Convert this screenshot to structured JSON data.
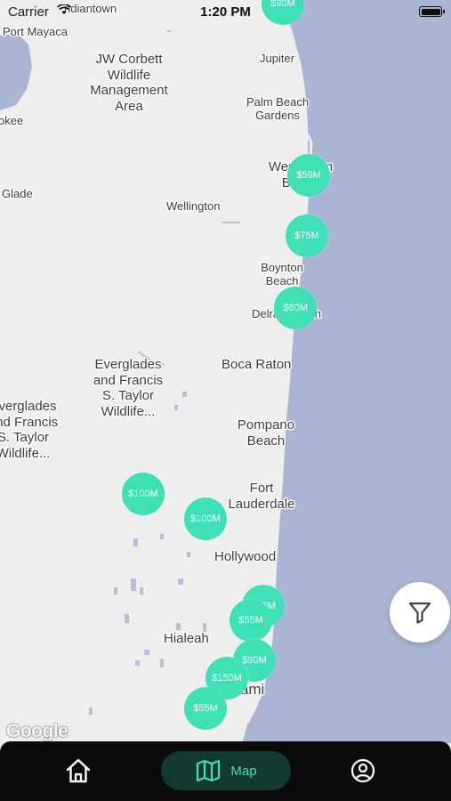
{
  "status_bar": {
    "carrier": "Carrier",
    "time": "1:20 PM"
  },
  "map": {
    "places": [
      {
        "id": "indiantown",
        "text": "ndiantown"
      },
      {
        "id": "port-mayaca",
        "text": "Port Mayaca"
      },
      {
        "id": "jw-corbett",
        "text": "JW Corbett Wildlife Management Area"
      },
      {
        "id": "jupiter",
        "text": "Jupiter"
      },
      {
        "id": "palm-beach-gardens",
        "text": "Palm Beach Gardens"
      },
      {
        "id": "okee",
        "text": "okee"
      },
      {
        "id": "west-palm-beach",
        "text": "West Palm Beach"
      },
      {
        "id": "glade",
        "text": "Glade"
      },
      {
        "id": "wellington",
        "text": "Wellington"
      },
      {
        "id": "boynton-beach",
        "text": "Boynton Beach"
      },
      {
        "id": "delray-beach",
        "text": "Delray Beach"
      },
      {
        "id": "everglades-1",
        "text": "Everglades and Francis S. Taylor Wildlife..."
      },
      {
        "id": "boca-raton",
        "text": "Boca Raton"
      },
      {
        "id": "everglades-2",
        "text": "Everglades and Francis S. Taylor Wildlife..."
      },
      {
        "id": "pompano-beach",
        "text": "Pompano Beach"
      },
      {
        "id": "fort-lauderdale",
        "text": "Fort Lauderdale"
      },
      {
        "id": "hollywood",
        "text": "Hollywood"
      },
      {
        "id": "hialeah",
        "text": "Hialeah"
      },
      {
        "id": "miami",
        "text": "Miami"
      }
    ],
    "pins": [
      {
        "id": "pin-top",
        "label": "$90M"
      },
      {
        "id": "pin-wpb",
        "label": "$59M"
      },
      {
        "id": "pin-boynton-n",
        "label": "$75M"
      },
      {
        "id": "pin-delray",
        "label": "$60M"
      },
      {
        "id": "pin-everglades",
        "label": "$100M"
      },
      {
        "id": "pin-weston",
        "label": "$100M"
      },
      {
        "id": "pin-aventura",
        "label": "$55M"
      },
      {
        "id": "pin-aventura-back",
        "label": "$55M"
      },
      {
        "id": "pin-northmiami",
        "label": "$90M"
      },
      {
        "id": "pin-miami-n",
        "label": "$150M"
      },
      {
        "id": "pin-miami-s",
        "label": "$55M"
      }
    ],
    "attribution": "Google",
    "colors": {
      "land": "#eeeeee",
      "water": "#aab5d3",
      "pin": "#3fe0b5"
    }
  },
  "filter_button": {
    "icon": "filter-icon"
  },
  "tab_bar": {
    "home_icon": "home-icon",
    "map_icon": "map-icon",
    "map_label": "Map",
    "profile_icon": "profile-icon",
    "active_color": "#3fe0b5"
  }
}
